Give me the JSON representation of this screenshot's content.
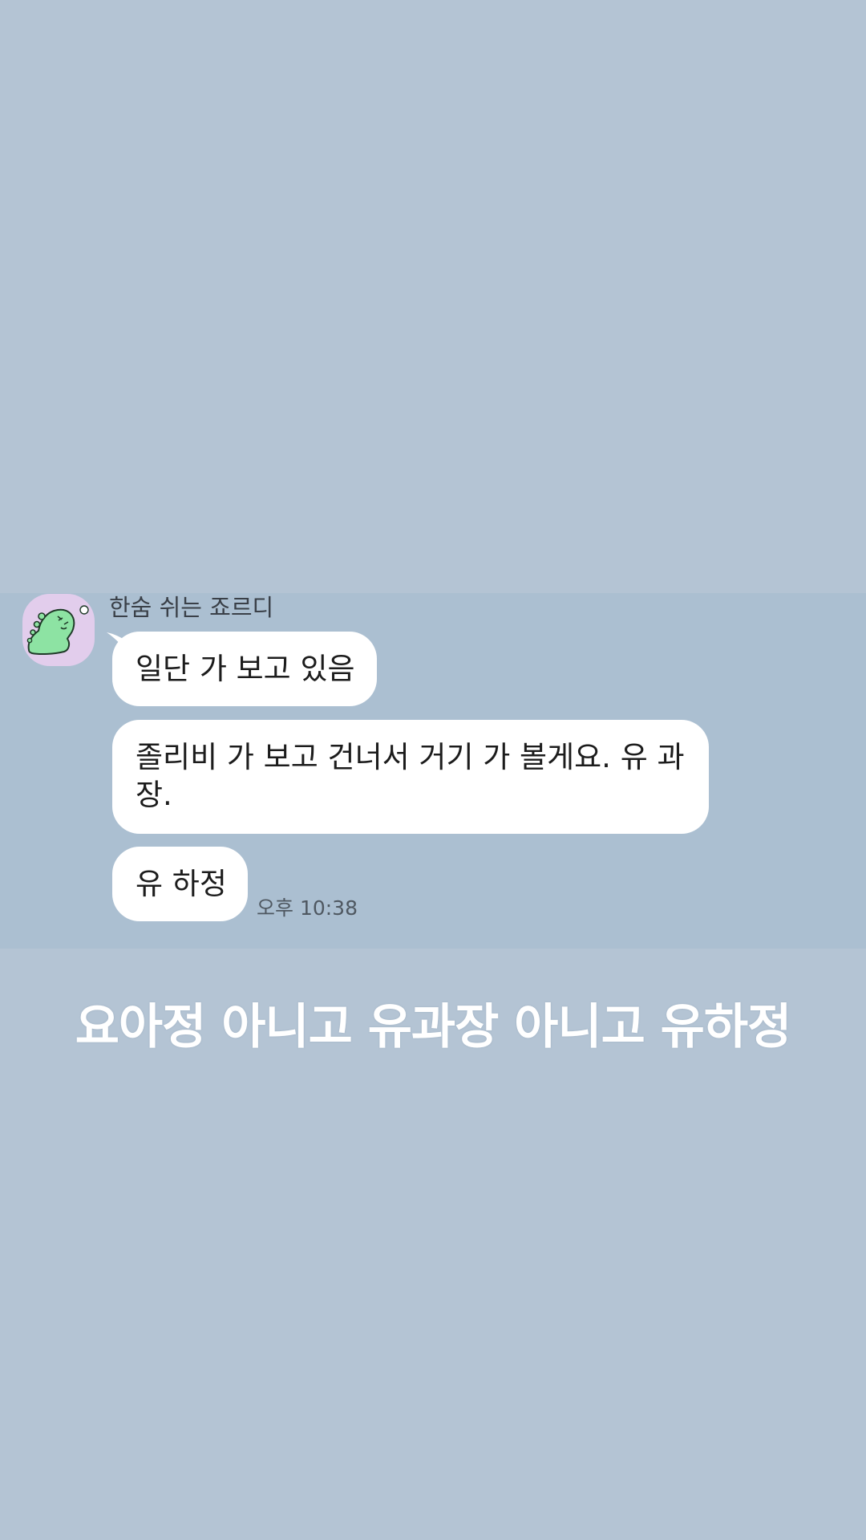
{
  "colors": {
    "background": "#b4c4d4",
    "chat_panel": "#abbfd1",
    "bubble": "#ffffff",
    "avatar_bg": "#e2cdec",
    "dino": "#8de3a3",
    "caption_text": "#ffffff"
  },
  "chat": {
    "sender": {
      "name": "한숨 쉬는 죠르디",
      "avatar_icon": "green-dinosaur-avatar-icon"
    },
    "messages": [
      {
        "text": "일단 가 보고 있음"
      },
      {
        "text": "졸리비 가 보고 건너서 거기 가 볼게요. 유 과장."
      },
      {
        "text": "유 하정"
      }
    ],
    "timestamp": "오후 10:38"
  },
  "caption": {
    "text": "요아정 아니고 유과장 아니고 유하정"
  }
}
